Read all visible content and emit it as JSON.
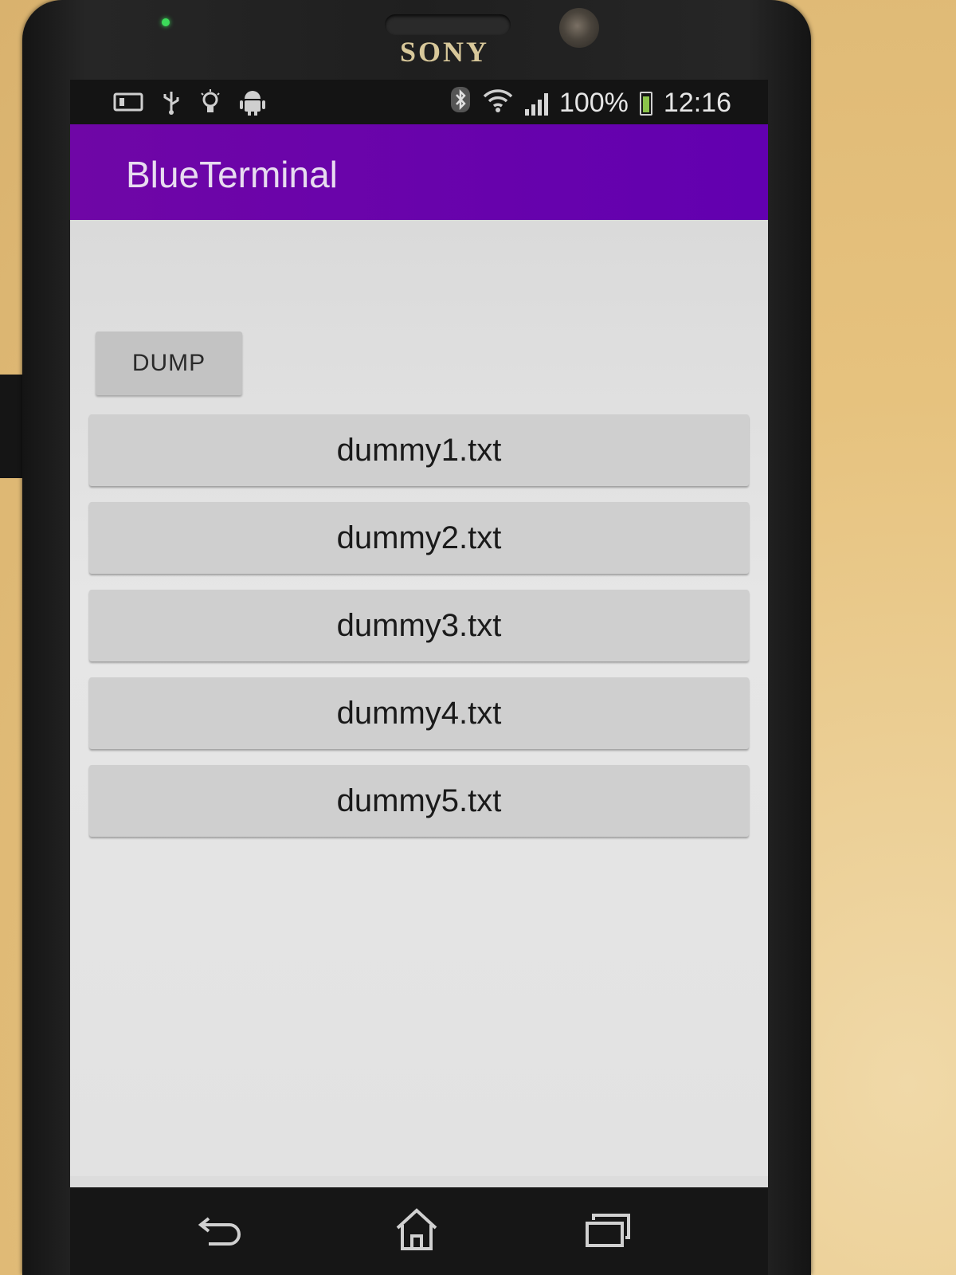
{
  "device": {
    "brand": "SONY"
  },
  "status_bar": {
    "battery": "100%",
    "time": "12:16",
    "left_icons": [
      "screenshot-icon",
      "usb-icon",
      "lightbulb-icon",
      "android-icon"
    ],
    "right_icons": [
      "bluetooth-icon",
      "wifi-icon",
      "signal-icon",
      "battery-icon"
    ]
  },
  "app_bar": {
    "title": "BlueTerminal",
    "color": "#6a00a8"
  },
  "main": {
    "dump_label": "DUMP",
    "files": [
      {
        "label": "dummy1.txt"
      },
      {
        "label": "dummy2.txt"
      },
      {
        "label": "dummy3.txt"
      },
      {
        "label": "dummy4.txt"
      },
      {
        "label": "dummy5.txt"
      }
    ]
  },
  "nav_bar": {
    "buttons": [
      "back-icon",
      "home-icon",
      "recents-icon"
    ]
  }
}
